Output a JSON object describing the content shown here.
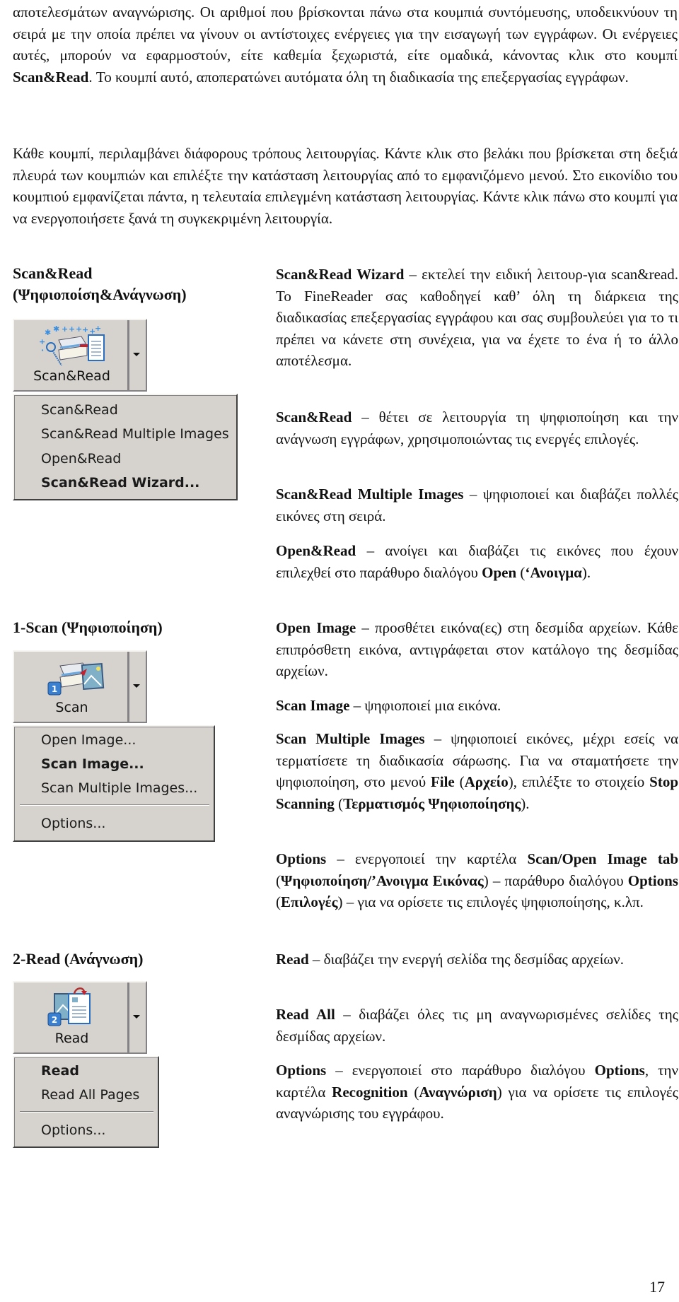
{
  "intro": {
    "p1_before": "αποτελεσμάτων αναγνώρισης. Οι αριθμοί που βρίσκονται πάνω στα κουμπιά συντόμευσης, υποδεικνύουν τη σειρά με την οποία πρέπει να γίνουν οι αντίστοιχες ενέργειες για την εισαγωγή των εγγράφων. Οι ενέργειες αυτές, μπορούν να εφαρμοστούν, είτε καθεμία ξεχωριστά, είτε ομαδικά, κάνοντας κλικ στο κουμπί ",
    "p1_bold": "Scan&Read",
    "p1_after": ". Το κουμπί αυτό, αποπερατώνει αυτόματα όλη τη διαδικασία της επεξεργασίας εγγράφων.",
    "p2": "Κάθε κουμπί, περιλαμβάνει διάφορους τρόπους λειτουργίας. Κάντε κλικ στο βελάκι που βρίσκεται στη δεξιά πλευρά των κουμπιών και επιλέξτε την κατάσταση λειτουργίας από το εμφανιζόμενο μενού. Στο εικονίδιο του κουμπιού εμφανίζεται πάντα, η τελευταία επιλεγμένη κατάσταση λειτουργίας. Κάντε κλικ πάνω στο κουμπί για να ενεργοποιήσετε ξανά τη συγκεκριμένη λειτουργία."
  },
  "sections": [
    {
      "title_line1": "Scan&Read",
      "title_line2": "(Ψηφιοποίση&Ανάγνωση)",
      "button_label": "Scan&Read",
      "button_icon": "scan-read-wizard-icon",
      "menu": [
        {
          "label": "Scan&Read",
          "bold": false
        },
        {
          "label": "Scan&Read Multiple Images",
          "bold": false
        },
        {
          "label": "Open&Read",
          "bold": false
        },
        {
          "label": "Scan&Read Wizard...",
          "bold": true
        }
      ]
    },
    {
      "title_line1": "1-Scan (Ψηφιοποίηση)",
      "button_label": "Scan",
      "button_icon": "scan-icon",
      "button_badge": "1",
      "menu": [
        {
          "label": "Open Image...",
          "bold": false
        },
        {
          "label": "Scan Image...",
          "bold": true
        },
        {
          "label": "Scan Multiple Images...",
          "bold": false
        },
        {
          "label": "Options...",
          "bold": false
        }
      ]
    },
    {
      "title_line1": "2-Read (Ανάγνωση)",
      "button_label": "Read",
      "button_icon": "read-icon",
      "button_badge": "2",
      "menu": [
        {
          "label": "Read",
          "bold": true
        },
        {
          "label": "Read All Pages",
          "bold": false
        },
        {
          "label": "Options...",
          "bold": false
        }
      ]
    }
  ],
  "descriptions": {
    "wizard": {
      "term": "Scan&Read Wizard",
      "text": " – εκτελεί την ειδική λειτουρ-για scan&read. Το FineReader σας καθοδηγεί καθ’ όλη τη διάρκεια της διαδικασίας  επεξεργασίας εγγράφου και σας συμβουλεύει για το τι πρέπει να κάνετε στη συνέχεια, για να έχετε το ένα ή το άλλο αποτέλεσμα."
    },
    "scanread": {
      "term": "Scan&Read",
      "text": " – θέτει σε λειτουργία τη ψηφιοποίηση και την ανάγνωση εγγράφων, χρησιμοποιώντας τις ενεργές επιλογές."
    },
    "scanread_multi": {
      "term": "Scan&Read Multiple Images",
      "text": " – ψηφιοποιεί και διαβάζει πολλές εικόνες στη σειρά."
    },
    "openread": {
      "term": "Open&Read",
      "text": " – ανοίγει και διαβάζει τις εικόνες που έχουν επιλεχθεί στο παράθυρο διαλόγου ",
      "term2": "Open",
      "text2": " (",
      "term3": "‘Ανοιγμα",
      "text3": ")."
    },
    "open_image": {
      "term": "Open Image",
      "text": " – προσθέτει εικόνα(ες) στη δεσμίδα αρχείων. Κάθε επιπρόσθετη εικόνα, αντιγράφεται στον κατάλογο της δεσμίδας αρχείων."
    },
    "scan_image": {
      "term": "Scan Image",
      "text": " – ψηφιοποιεί μια εικόνα."
    },
    "scan_multi": {
      "term": "Scan Multiple Images",
      "text": " – ψηφιοποιεί εικόνες, μέχρι εσείς να τερματίσετε τη διαδικασία σάρωσης. Για να σταματήσετε την ψηφιοποίηση, στο μενού ",
      "term2": "File",
      "text2": " (",
      "term3": "Αρχείο",
      "text3": "), επιλέξτε το στοιχείο ",
      "term4": "Stop Scanning",
      "text4": " (",
      "term5": "Τερματισμός Ψηφιοποίησης",
      "text5": ")."
    },
    "scan_options": {
      "term": "Options",
      "text": " – ενεργοποιεί την καρτέλα ",
      "term2": "Scan/Open Image tab",
      "text2": " (",
      "term3": "Ψηφιοποίηση/’Ανοιγμα Εικόνας",
      "text3": ") – παράθυρο διαλόγου ",
      "term4": "Options",
      "text4": " (",
      "term5": "Επιλογές",
      "text5": ") – για να ορίσετε τις επιλογές ψηφιοποίησης, κ.λπ."
    },
    "read": {
      "term": "Read",
      "text": " – διαβάζει την ενεργή σελίδα της δεσμίδας αρχείων."
    },
    "read_all": {
      "term": "Read All",
      "text": " – διαβάζει όλες τις μη αναγνωρισμένες σελίδες της δεσμίδας αρχείων."
    },
    "read_options": {
      "term": "Options",
      "text": " – ενεργοποιεί στο παράθυρο διαλόγου ",
      "term2": "Options",
      "text2": ", την καρτέλα ",
      "term3": "Recognition",
      "text3": " (",
      "term4": "Αναγνώριση",
      "text4": ") για να ορίσετε τις επιλογές αναγνώρισης του εγγράφου."
    }
  },
  "page_number": "17"
}
